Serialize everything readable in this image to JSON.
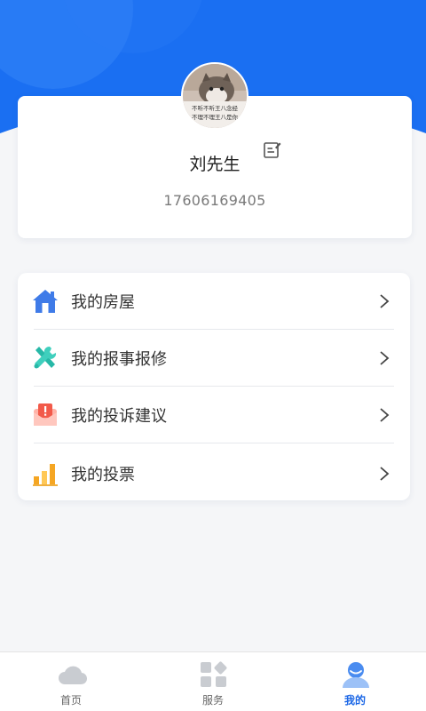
{
  "colors": {
    "primary": "#1469f0",
    "primary_light": "#2f80f7",
    "card_bg": "#ffffff",
    "page_bg": "#f5f6f8",
    "menu_text": "#333333",
    "phone_text": "#7a7a7a",
    "tab_active": "#1a66e6",
    "tab_inactive_icon": "#c9ccd1"
  },
  "profile": {
    "avatar_icon": "cat-avatar",
    "avatar_caption": "不听不听王八念经 不理不理王八是你",
    "name": "刘先生",
    "edit_icon": "edit-icon",
    "phone": "17606169405"
  },
  "menu": {
    "items": [
      {
        "label": "我的房屋",
        "icon": "house-icon"
      },
      {
        "label": "我的报事报修",
        "icon": "tools-icon"
      },
      {
        "label": "我的投诉建议",
        "icon": "complaint-icon"
      },
      {
        "label": "我的投票",
        "icon": "vote-chart-icon"
      }
    ]
  },
  "tabbar": {
    "tabs": [
      {
        "label": "首页",
        "icon": "cloud-icon",
        "active": false
      },
      {
        "label": "服务",
        "icon": "grid-icon",
        "active": false
      },
      {
        "label": "我的",
        "icon": "user-icon",
        "active": true
      }
    ]
  }
}
